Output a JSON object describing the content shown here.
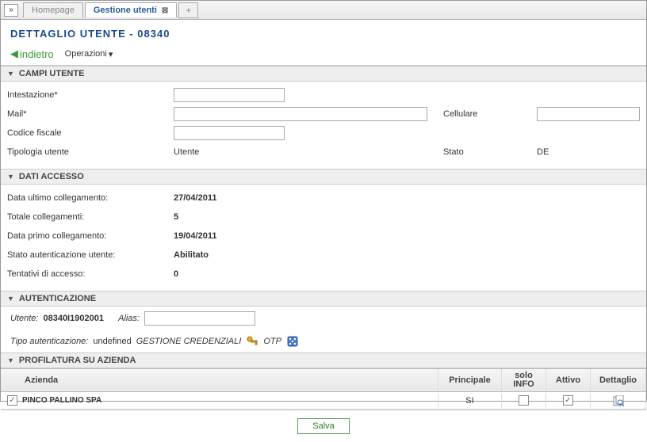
{
  "tabs": {
    "homepage": "Homepage",
    "active": "Gestione utenti"
  },
  "page_title": "DETTAGLIO UTENTE - 08340",
  "toolbar": {
    "back": "indietro",
    "ops": "Operazioni"
  },
  "sections": {
    "campi_utente": "CAMPI UTENTE",
    "dati_accesso": "DATI ACCESSO",
    "autenticazione": "AUTENTICAZIONE",
    "profilatura": "PROFILATURA SU AZIENDA"
  },
  "campi": {
    "intestazione_label": "Intestazione*",
    "intestazione_value": "",
    "mail_label": "Mail*",
    "mail_value": "",
    "cellulare_label": "Cellulare",
    "cellulare_value": "",
    "codice_fiscale_label": "Codice fiscale",
    "codice_fiscale_value": "",
    "tipologia_label": "Tipologia utente",
    "tipologia_value": "Utente",
    "stato_label": "Stato",
    "stato_value": "DE"
  },
  "dati": {
    "ultimo_label": "Data ultimo collegamento:",
    "ultimo_value": "27/04/2011",
    "totale_label": "Totale collegamenti:",
    "totale_value": "5",
    "primo_label": "Data primo collegamento:",
    "primo_value": "19/04/2011",
    "stato_auth_label": "Stato autenticazione utente:",
    "stato_auth_value": "Abilitato",
    "tentativi_label": "Tentativi di accesso:",
    "tentativi_value": "0"
  },
  "auth": {
    "utente_label": "Utente:",
    "utente_value": "08340I1902001",
    "alias_label": "Alias:",
    "alias_value": "",
    "tipo_label": "Tipo autenticazione:",
    "tipo_value": "undefined",
    "gestione_cred": "GESTIONE CREDENZIALI",
    "otp": "OTP"
  },
  "table": {
    "h_azienda": "Azienda",
    "h_principale": "Principale",
    "h_solo_info": "solo INFO",
    "h_attivo": "Attivo",
    "h_dettaglio": "Dettaglio",
    "row": {
      "checked": "✓",
      "azienda": "PINCO PALLINO SPA",
      "principale": "SI",
      "solo_info": false,
      "attivo": true
    }
  },
  "buttons": {
    "salva": "Salva"
  }
}
